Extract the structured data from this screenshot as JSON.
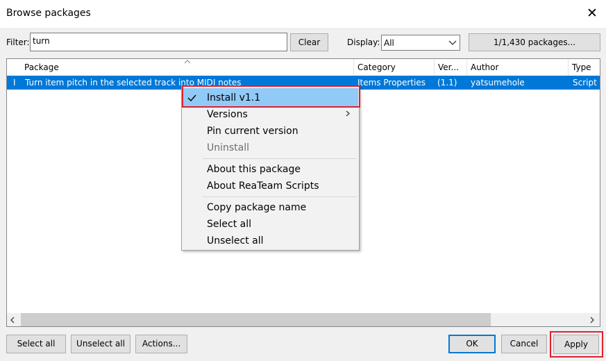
{
  "window": {
    "title": "Browse packages"
  },
  "filter": {
    "label": "Filter:",
    "value": "turn",
    "clear_label": "Clear"
  },
  "display": {
    "label": "Display:",
    "value": "All"
  },
  "packages_button": "1/1,430 packages...",
  "table": {
    "columns": [
      "Package",
      "Category",
      "Ver...",
      "Author",
      "Type"
    ],
    "rows": [
      {
        "status": "I",
        "package": "Turn item pitch in the selected track into MIDI notes",
        "category": "Items Properties",
        "version": "(1.1)",
        "author": "yatsumehole",
        "type": "Script"
      }
    ]
  },
  "context_menu": {
    "items": [
      {
        "label": "Install v1.1",
        "checked": true,
        "highlighted": true
      },
      {
        "label": "Versions",
        "submenu": true
      },
      {
        "label": "Pin current version"
      },
      {
        "label": "Uninstall",
        "disabled": true
      },
      {
        "label": "About this package"
      },
      {
        "label": "About ReaTeam Scripts"
      },
      {
        "label": "Copy package name"
      },
      {
        "label": "Select all"
      },
      {
        "label": "Unselect all"
      }
    ]
  },
  "footer": {
    "select_all": "Select all",
    "unselect_all": "Unselect all",
    "actions": "Actions...",
    "ok": "OK",
    "cancel": "Cancel",
    "apply": "Apply"
  },
  "colors": {
    "selection": "#0078d7",
    "menu_highlight": "#91c9f7",
    "annotation_red": "#e0202e",
    "disabled_text": "#6d6d6d"
  }
}
